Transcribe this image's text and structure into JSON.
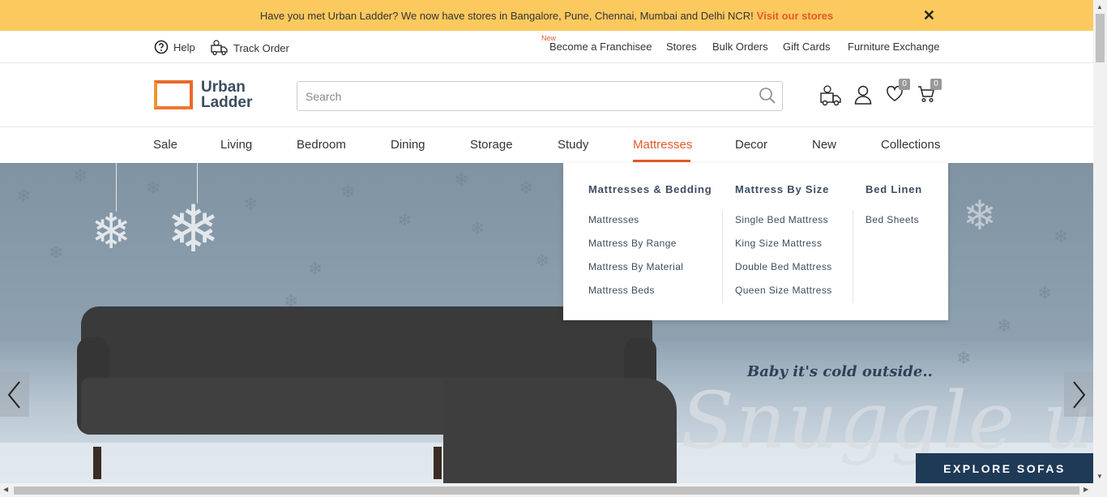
{
  "announcement": {
    "text": "Have you met Urban Ladder? We now have stores in Bangalore, Pune, Chennai, Mumbai and Delhi NCR!",
    "link": "Visit our stores",
    "close": "✕"
  },
  "util_bar": {
    "help": "Help",
    "track_order": "Track Order",
    "new_tag": "New",
    "links": [
      "Become a Franchisee",
      "Stores",
      "Bulk Orders",
      "Gift Cards",
      "Furniture Exchange"
    ]
  },
  "header": {
    "logo_line1": "Urban",
    "logo_line2": "Ladder",
    "search_placeholder": "Search",
    "wishlist_count": "0",
    "cart_count": "0"
  },
  "nav": {
    "items": [
      "Sale",
      "Living",
      "Bedroom",
      "Dining",
      "Storage",
      "Study",
      "Mattresses",
      "Decor",
      "New",
      "Collections"
    ],
    "active": "Mattresses"
  },
  "mega_menu": {
    "columns": [
      {
        "heading": "Mattresses & Bedding",
        "items": [
          "Mattresses",
          "Mattress By Range",
          "Mattress By Material",
          "Mattress Beds"
        ]
      },
      {
        "heading": "Mattress By Size",
        "items": [
          "Single Bed Mattress",
          "King Size Mattress",
          "Double Bed Mattress",
          "Queen Size Mattress"
        ]
      },
      {
        "heading": "Bed Linen",
        "items": [
          "Bed Sheets"
        ]
      }
    ]
  },
  "hero": {
    "tagline": "Baby it's cold outside..",
    "script_text": "Snuggle up",
    "cta": "EXPLORE SOFAS"
  },
  "colors": {
    "accent": "#e35a2b",
    "announcement_bg": "#fcc95f",
    "navy": "#1e3a57"
  }
}
